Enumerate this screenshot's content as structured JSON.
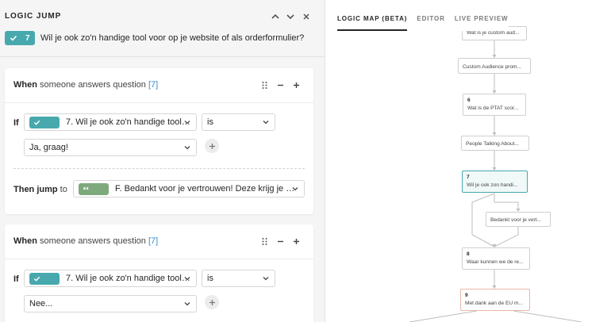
{
  "logic_jump": {
    "title": "LOGIC JUMP",
    "question_number": "7",
    "question_text": "Wil je ook zo'n handige tool voor op je website of als orderformulier?"
  },
  "rules": [
    {
      "when_prefix": "When",
      "when_rest": " someone answers question ",
      "question_ref": "[7]",
      "if_label": "If",
      "question_select": "7. Wil je ook zo'n handige tool v...",
      "operator": "is",
      "value": "Ja, graag!",
      "then_bold": "Then jump",
      "then_rest": " to",
      "target": "F. Bedankt voor je vertrouwen! Deze krijg je GR..."
    },
    {
      "when_prefix": "When",
      "when_rest": " someone answers question ",
      "question_ref": "[7]",
      "if_label": "If",
      "question_select": "7. Wil je ook zo'n handige tool v...",
      "operator": "is",
      "value": "Nee..."
    }
  ],
  "tabs": [
    "LOGIC MAP (BETA)",
    "EDITOR",
    "LIVE PREVIEW"
  ],
  "map_nodes": [
    {
      "num": "",
      "text": "Wat is je custom aud..."
    },
    {
      "num": "",
      "text": "Custom Audience prom..."
    },
    {
      "num": "6",
      "text": "Wat is de PTAT scor..."
    },
    {
      "num": "",
      "text": "People Talking About..."
    },
    {
      "num": "7",
      "text": "Wil je ook zon handi..."
    },
    {
      "num": "",
      "text": "Bedankt voor je vert..."
    },
    {
      "num": "8",
      "text": "Waar kunnen we de re..."
    },
    {
      "num": "9",
      "text": "Met dank aan de EU m..."
    }
  ],
  "colors": {
    "accent": "#47a8ad",
    "link": "#3c8ecf",
    "green_badge": "#7ea97d"
  }
}
